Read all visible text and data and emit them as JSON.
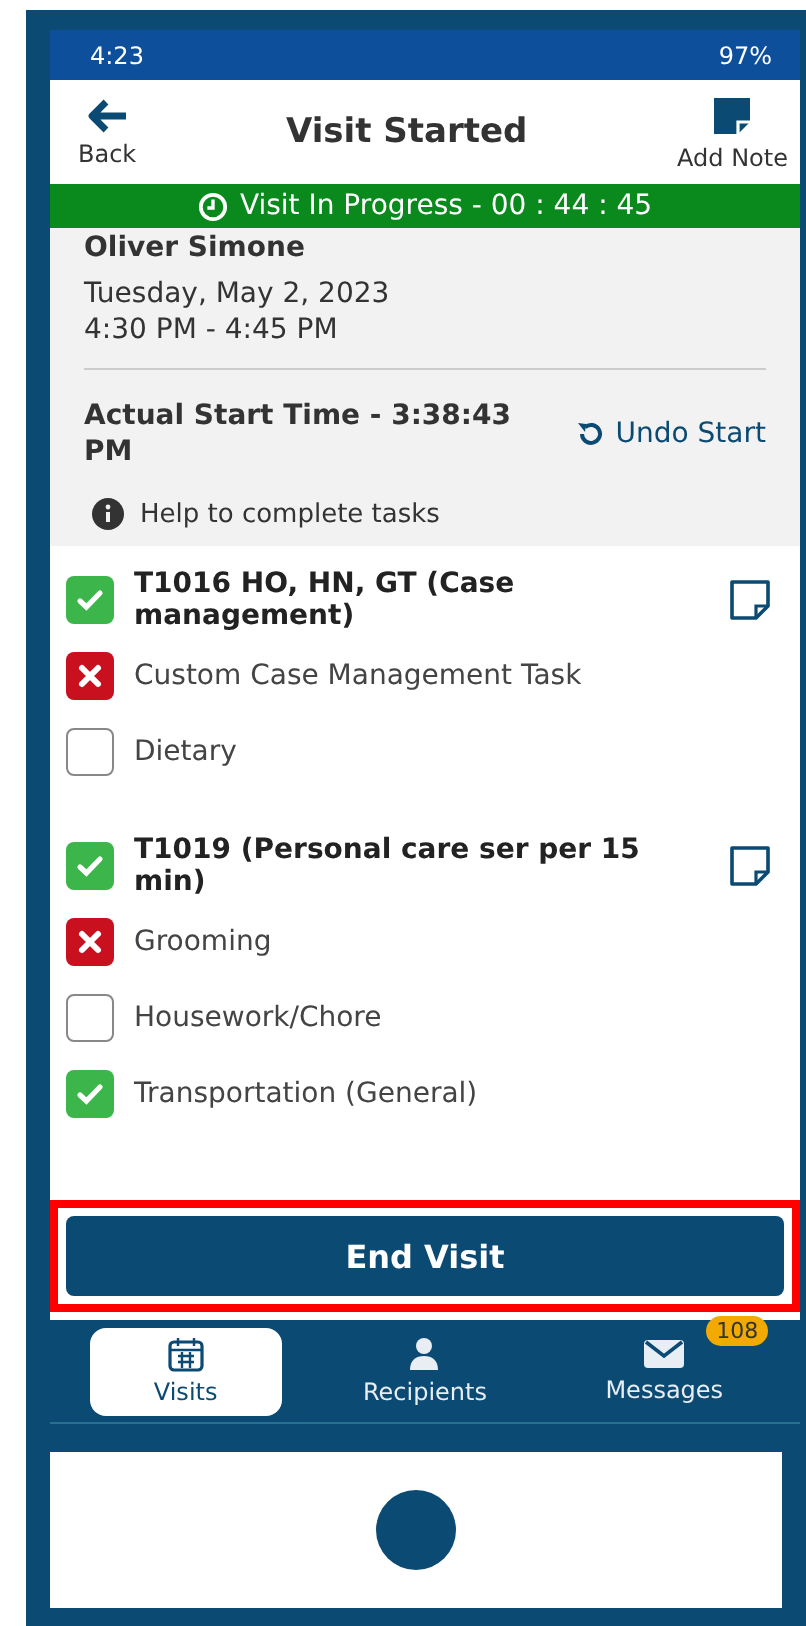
{
  "status_bar": {
    "time": "4:23",
    "battery": "97%"
  },
  "header": {
    "back_label": "Back",
    "title": "Visit Started",
    "note_label": "Add Note"
  },
  "progress_banner": {
    "text": "Visit In Progress - 00 : 44 : 45"
  },
  "visit": {
    "recipient": "Oliver Simone",
    "date": "Tuesday, May 2, 2023",
    "time_range": "4:30 PM - 4:45 PM",
    "actual_start": "Actual Start Time - 3:38:43 PM",
    "undo_label": "Undo Start",
    "help_text": "Help to complete tasks"
  },
  "task_groups": [
    {
      "title": "T1016 HO, HN, GT (Case management)",
      "kind": "checked",
      "tasks": [
        {
          "label": "Custom Case Management Task",
          "kind": "refused"
        },
        {
          "label": "Dietary",
          "kind": "unchecked"
        }
      ]
    },
    {
      "title": "T1019  (Personal care ser per 15 min)",
      "kind": "checked",
      "tasks": [
        {
          "label": "Grooming",
          "kind": "refused"
        },
        {
          "label": "Housework/Chore",
          "kind": "unchecked"
        },
        {
          "label": "Transportation (General)",
          "kind": "checked"
        }
      ]
    }
  ],
  "end_button": {
    "label": "End Visit"
  },
  "nav": [
    {
      "label": "Visits",
      "selected": true
    },
    {
      "label": "Recipients",
      "selected": false
    },
    {
      "label": "Messages",
      "selected": false,
      "badge": "108"
    }
  ]
}
